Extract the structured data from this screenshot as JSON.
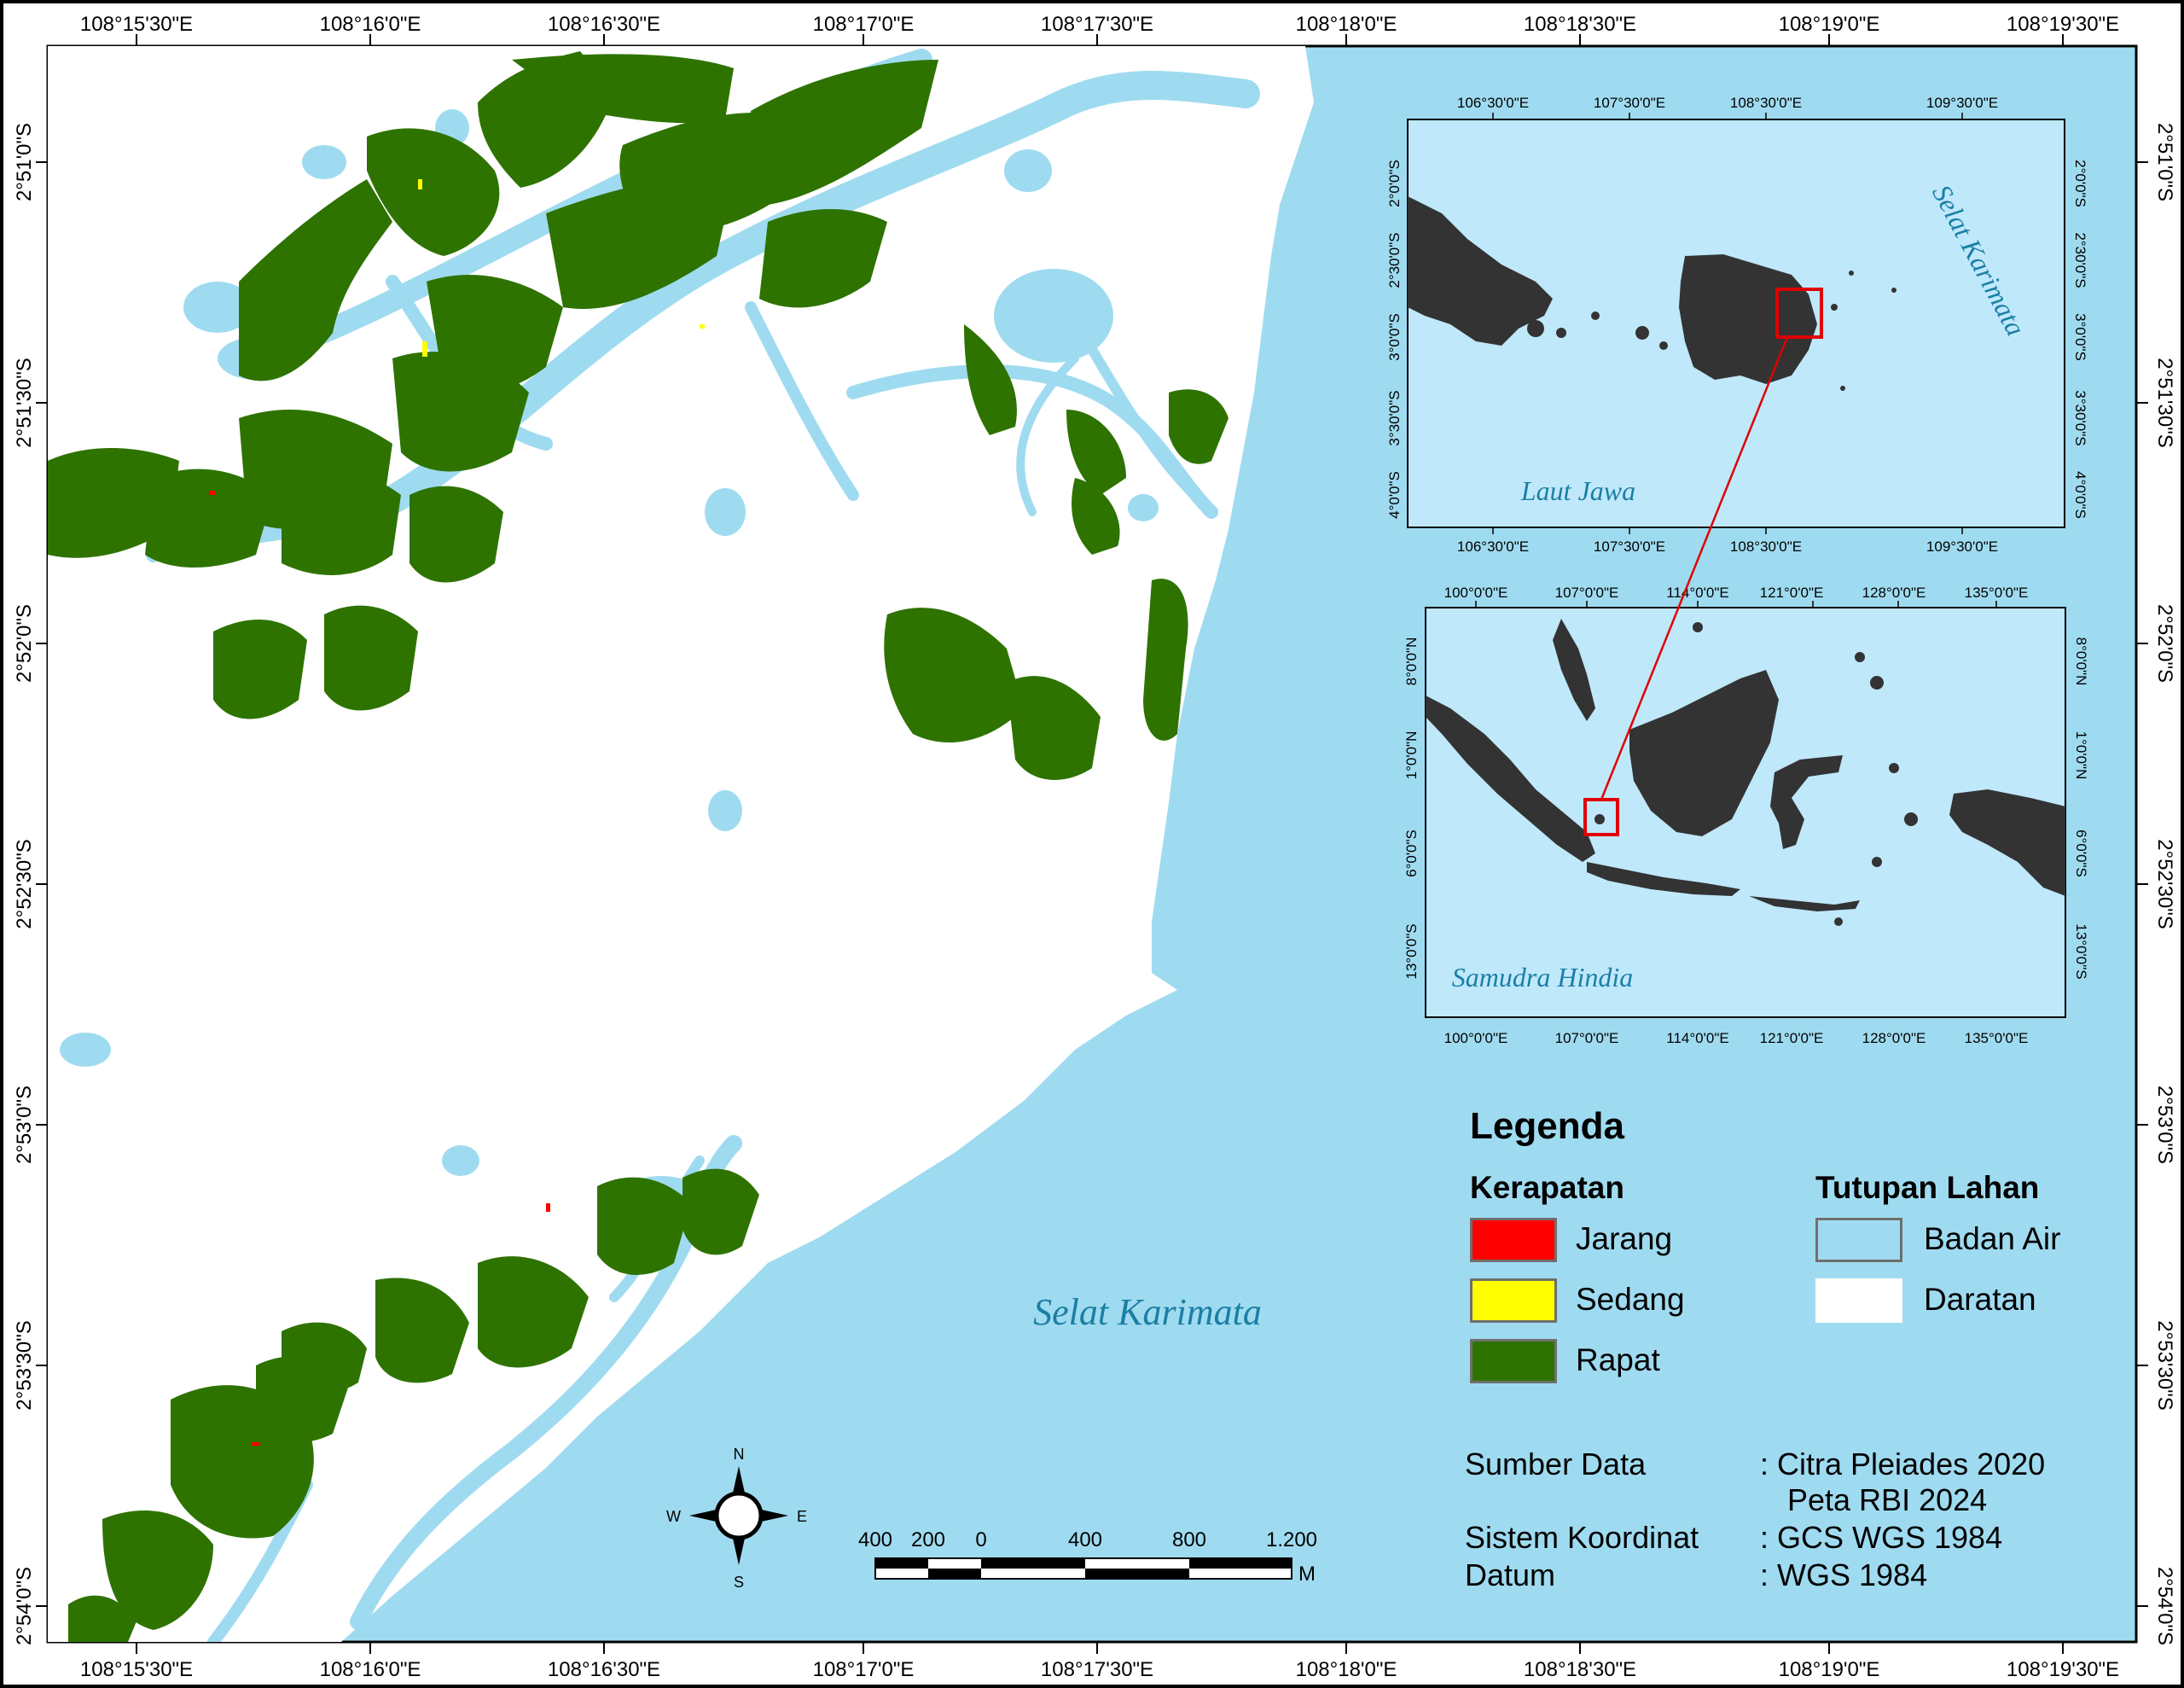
{
  "map": {
    "axis_labels": {
      "top": [
        "108°15'30\"E",
        "108°16'0\"E",
        "108°16'30\"E",
        "108°17'0\"E",
        "108°17'30\"E",
        "108°18'0\"E",
        "108°18'30\"E",
        "108°19'0\"E",
        "108°19'30\"E"
      ],
      "bottom": [
        "108°15'30\"E",
        "108°16'0\"E",
        "108°16'30\"E",
        "108°17'0\"E",
        "108°17'30\"E",
        "108°18'0\"E",
        "108°18'30\"E",
        "108°19'0\"E",
        "108°19'30\"E"
      ],
      "left": [
        "2°51'0\"S",
        "2°51'30\"S",
        "2°52'0\"S",
        "2°52'30\"S",
        "2°53'0\"S",
        "2°53'30\"S",
        "2°54'0\"S"
      ],
      "right": [
        "2°51'0\"S",
        "2°51'30\"S",
        "2°52'0\"S",
        "2°52'30\"S",
        "2°53'0\"S",
        "2°53'30\"S",
        "2°54'0\"S"
      ]
    },
    "sea_label": "Selat Karimata",
    "colors": {
      "sea": "#9fdbf0",
      "land": "#ffffff",
      "mangrove_dense": "#2e7300",
      "mangrove_medium": "#ffff00",
      "mangrove_sparse": "#ff0000",
      "inset_land": "#333333",
      "inset_sea": "#bfe8fb"
    }
  },
  "inset_top": {
    "top_labels": [
      "106°30'0\"E",
      "107°30'0\"E",
      "108°30'0\"E",
      "109°30'0\"E"
    ],
    "bottom_labels": [
      "106°30'0\"E",
      "107°30'0\"E",
      "108°30'0\"E",
      "109°30'0\"E"
    ],
    "left_labels": [
      "2°0'0\"S",
      "2°30'0\"S",
      "3°0'0\"S",
      "3°30'0\"S",
      "4°0'0\"S"
    ],
    "right_labels": [
      "2°0'0\"S",
      "2°30'0\"S",
      "3°0'0\"S",
      "3°30'0\"S",
      "4°0'0\"S"
    ],
    "sea_label_1": "Selat Karimata",
    "sea_label_2": "Laut Jawa"
  },
  "inset_bottom": {
    "top_labels": [
      "100°0'0\"E",
      "107°0'0\"E",
      "114°0'0\"E",
      "121°0'0\"E",
      "128°0'0\"E",
      "135°0'0\"E"
    ],
    "bottom_labels": [
      "100°0'0\"E",
      "107°0'0\"E",
      "114°0'0\"E",
      "121°0'0\"E",
      "128°0'0\"E",
      "135°0'0\"E"
    ],
    "left_labels": [
      "8°0'0\"N",
      "1°0'0\"N",
      "6°0'0\"S",
      "13°0'0\"S"
    ],
    "right_labels": [
      "8°0'0\"N",
      "1°0'0\"N",
      "6°0'0\"S",
      "13°0'0\"S"
    ],
    "sea_label": "Samudra Hindia"
  },
  "north_arrow": {
    "n": "N",
    "s": "S",
    "e": "E",
    "w": "W"
  },
  "scale_bar": {
    "labels": [
      "400",
      "200",
      "0",
      "400",
      "800",
      "1.200"
    ],
    "unit": "M"
  },
  "legend": {
    "title": "Legenda",
    "density_title": "Kerapatan",
    "density_items": [
      {
        "label": "Jarang",
        "color": "#ff0000"
      },
      {
        "label": "Sedang",
        "color": "#ffff00"
      },
      {
        "label": "Rapat",
        "color": "#2e7300"
      }
    ],
    "cover_title": "Tutupan Lahan",
    "cover_items": [
      {
        "label": "Badan Air",
        "color": "#9fdbf0"
      },
      {
        "label": "Daratan",
        "color": "#ffffff"
      }
    ],
    "meta": [
      {
        "key": "Sumber Data",
        "value": ": Citra Pleiades 2020"
      },
      {
        "key": "",
        "value": "Peta RBI 2024"
      },
      {
        "key": "Sistem Koordinat",
        "value": ": GCS WGS 1984"
      },
      {
        "key": "Datum",
        "value": ": WGS 1984"
      }
    ]
  }
}
